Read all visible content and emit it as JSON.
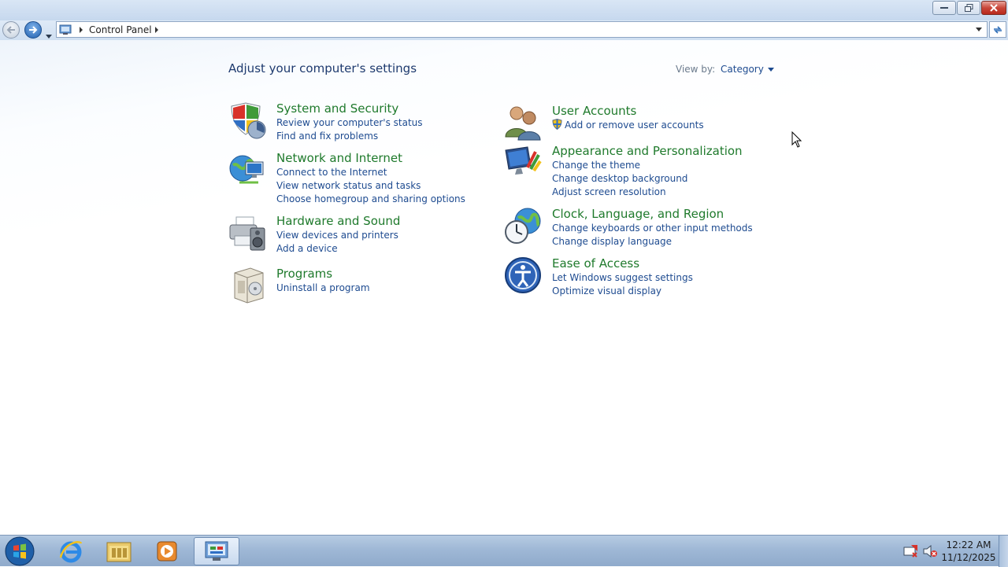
{
  "window": {
    "caption_buttons": [
      "minimize",
      "restore",
      "close"
    ]
  },
  "address_bar": {
    "crumbs": [
      "Control Panel"
    ]
  },
  "content": {
    "heading": "Adjust your computer's settings",
    "view_by_label": "View by:",
    "view_by_value": "Category",
    "categories": [
      {
        "title": "System and Security",
        "links": [
          "Review your computer's status",
          "Find and fix problems"
        ],
        "icon": "shield-icon"
      },
      {
        "title": "Network and Internet",
        "links": [
          "Connect to the Internet",
          "View network status and tasks",
          "Choose homegroup and sharing options"
        ],
        "icon": "network-globe-icon"
      },
      {
        "title": "Hardware and Sound",
        "links": [
          "View devices and printers",
          "Add a device"
        ],
        "icon": "printer-speaker-icon"
      },
      {
        "title": "Programs",
        "links": [
          "Uninstall a program"
        ],
        "icon": "programs-box-icon"
      },
      {
        "title": "User Accounts",
        "links": [
          "Add or remove user accounts"
        ],
        "icon": "users-icon"
      },
      {
        "title": "Appearance and Personalization",
        "links": [
          "Change the theme",
          "Change desktop background",
          "Adjust screen resolution"
        ],
        "icon": "monitor-paint-icon"
      },
      {
        "title": "Clock, Language, and Region",
        "links": [
          "Change keyboards or other input methods",
          "Change display language"
        ],
        "icon": "clock-globe-icon"
      },
      {
        "title": "Ease of Access",
        "links": [
          "Let Windows suggest settings",
          "Optimize visual display"
        ],
        "icon": "ease-of-access-icon"
      }
    ]
  },
  "taskbar": {
    "pinned": [
      "internet-explorer-icon",
      "file-explorer-icon",
      "media-player-icon",
      "control-panel-icon"
    ],
    "tray": [
      "action-center-icon",
      "volume-muted-icon"
    ],
    "time": "12:22 AM",
    "date": "11/12/2025"
  },
  "colors": {
    "category_title": "#1f7a2c",
    "link": "#1e4b90",
    "heading": "#1e3a6e"
  }
}
